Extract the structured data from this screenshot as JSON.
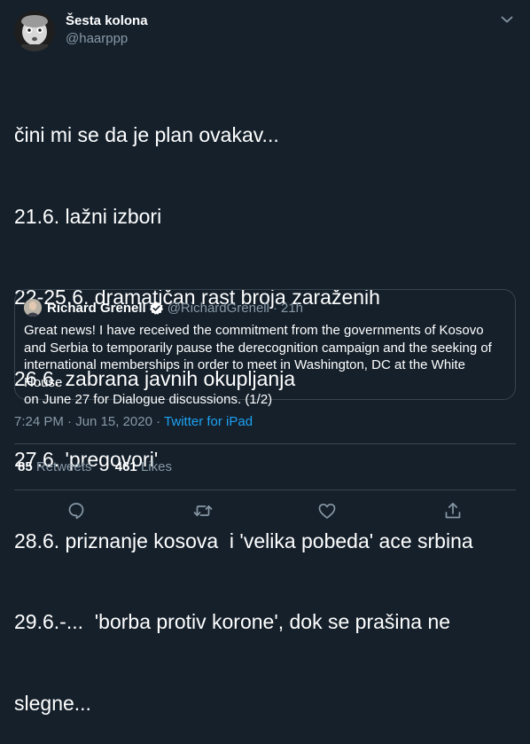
{
  "author": {
    "display_name": "Šesta kolona",
    "handle": "@haarppp"
  },
  "icons": {
    "menu": "chevron-down-icon",
    "verified": "verified-badge-icon",
    "reply": "reply-icon",
    "retweet": "retweet-icon",
    "like": "heart-icon",
    "share": "share-icon"
  },
  "colors": {
    "background": "#15202b",
    "text": "#ffffff",
    "secondary_text": "#8899a6",
    "accent": "#1da1f2",
    "border": "#38444d"
  },
  "tweet": {
    "lines": [
      "čini mi se da je plan ovakav...",
      "21.6. lažni izbori",
      "22-25.6. dramatičan rast broja zaraženih",
      "26.6. zabrana javnih okupljanja",
      "27.6. 'pregovori'",
      "28.6. priznanje kosova  i 'velika pobeda' ace srbina",
      "29.6.-...  'borba protiv korone', dok se prašina ne",
      "slegne..."
    ]
  },
  "quote": {
    "name": "Richard Grenell",
    "handle": "@RichardGrenell",
    "separator": "·",
    "time": "21h",
    "text_lines": [
      "Great news! I have received the commitment from the governments of Kosovo",
      "and Serbia to temporarily pause the derecognition campaign and the seeking of",
      "international memberships in order to meet in Washington, DC at the White House",
      "on June 27 for Dialogue discussions. (1/2)"
    ]
  },
  "meta": {
    "time": "7:24 PM",
    "separator_1": "·",
    "date": "Jun 15, 2020",
    "separator_2": "·",
    "source": "Twitter for iPad"
  },
  "stats": {
    "retweets_count": "85",
    "retweets_label": "Retweets",
    "likes_count": "461",
    "likes_label": "Likes"
  }
}
